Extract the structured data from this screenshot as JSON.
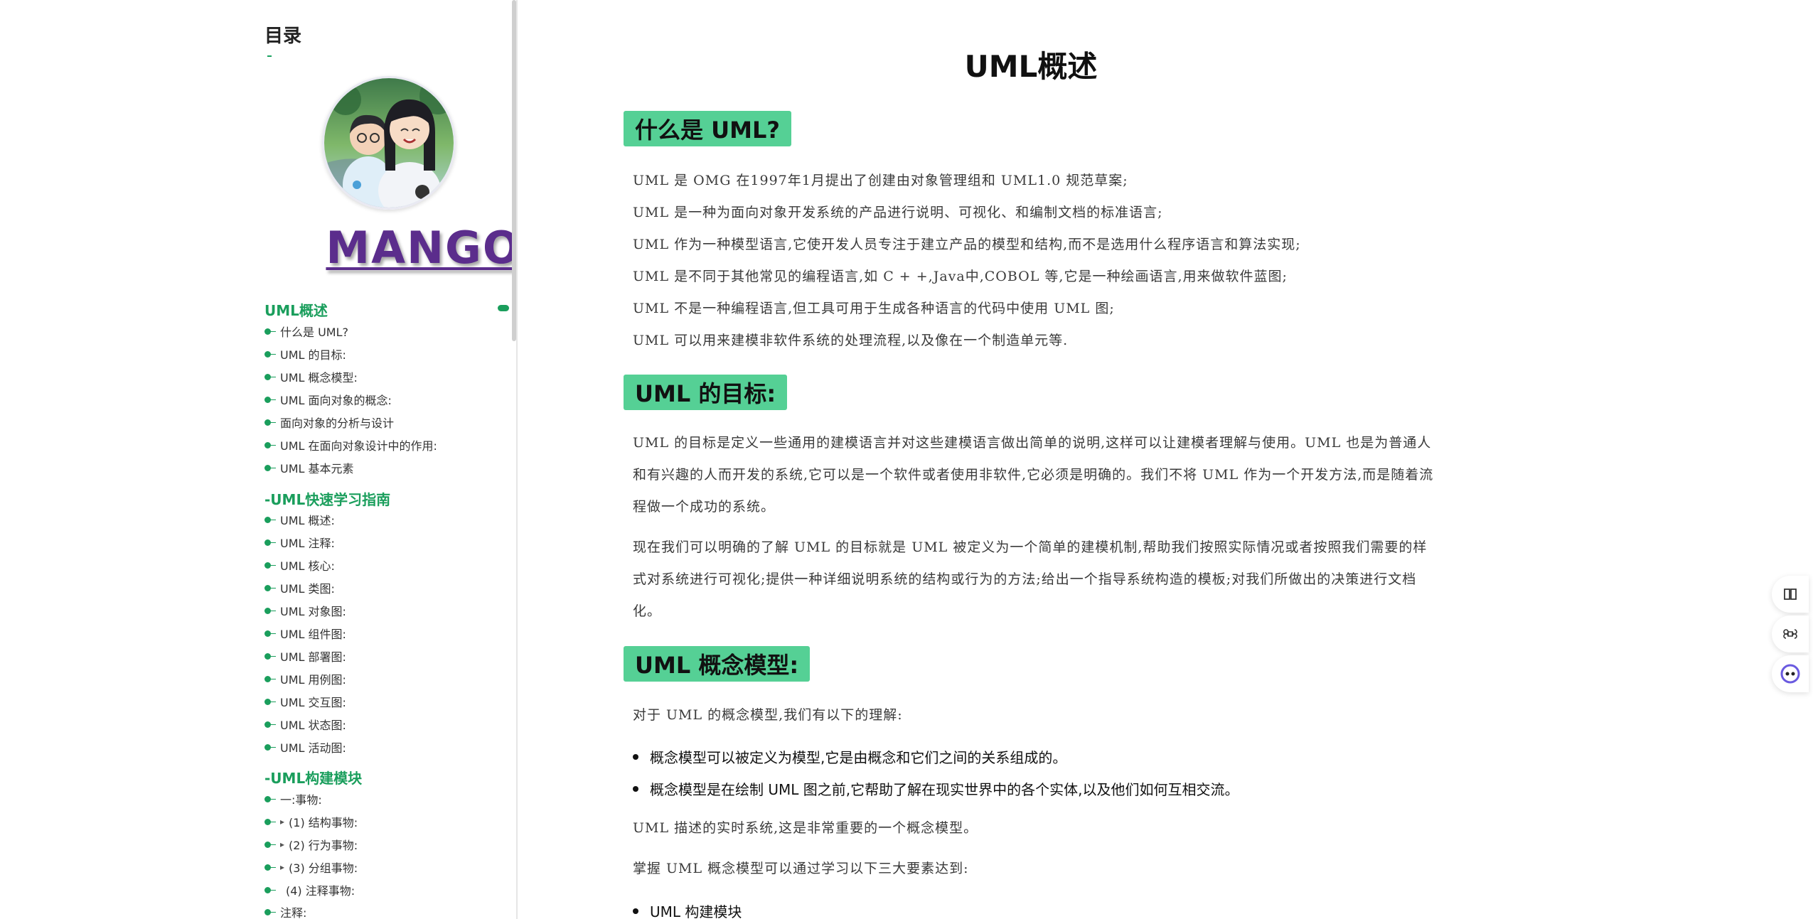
{
  "sidebar": {
    "toc_title": "目录",
    "brand": "MANGO",
    "sections": [
      {
        "title": "UML概述",
        "items": [
          "什么是 UML?",
          "UML 的目标:",
          "UML 概念模型:",
          "UML 面向对象的概念:",
          "面向对象的分析与设计",
          "UML 在面向对象设计中的作用:",
          "UML 基本元素"
        ]
      },
      {
        "title": "-UML快速学习指南",
        "items": [
          "UML 概述:",
          "UML 注释:",
          "UML 核心:",
          "UML 类图:",
          "UML 对象图:",
          "UML 组件图:",
          "UML 部署图:",
          "UML 用例图:",
          "UML 交互图:",
          "UML 状态图:",
          "UML 活动图:"
        ]
      },
      {
        "title": "-UML构建模块",
        "items": [
          "一:事物:",
          "(1) 结构事物:",
          "(2) 行为事物:",
          "(3) 分组事物:",
          "(4) 注释事物:",
          "注释:"
        ]
      }
    ]
  },
  "main": {
    "title": "UML概述",
    "section1": {
      "heading": "什么是 UML?",
      "lines": [
        "UML 是 OMG 在1997年1月提出了创建由对象管理组和 UML1.0 规范草案;",
        "UML 是一种为面向对象开发系统的产品进行说明、可视化、和编制文档的标准语言;",
        "UML 作为一种模型语言,它使开发人员专注于建立产品的模型和结构,而不是选用什么程序语言和算法实现;",
        "UML 是不同于其他常见的编程语言,如 C + +,Java中,COBOL 等,它是一种绘画语言,用来做软件蓝图;",
        "UML 不是一种编程语言,但工具可用于生成各种语言的代码中使用 UML 图;",
        "UML 可以用来建模非软件系统的处理流程,以及像在一个制造单元等."
      ]
    },
    "section2": {
      "heading": "UML 的目标:",
      "para1": "UML 的目标是定义一些通用的建模语言并对这些建模语言做出简单的说明,这样可以让建模者理解与使用。UML 也是为普通人和有兴趣的人而开发的系统,它可以是一个软件或者使用非软件,它必须是明确的。我们不将 UML 作为一个开发方法,而是随着流程做一个成功的系统。",
      "para2": "现在我们可以明确的了解 UML 的目标就是 UML 被定义为一个简单的建模机制,帮助我们按照实际情况或者按照我们需要的样式对系统进行可视化;提供一种详细说明系统的结构或行为的方法;给出一个指导系统构造的模板;对我们所做出的决策进行文档化。"
    },
    "section3": {
      "heading": "UML 概念模型:",
      "intro": "对于 UML 的概念模型,我们有以下的理解:",
      "bullets": [
        "概念模型可以被定义为模型,它是由概念和它们之间的关系组成的。",
        "概念模型是在绘制 UML 图之前,它帮助了解在现实世界中的各个实体,以及他们如何互相交流。"
      ],
      "para1": "UML 描述的实时系统,这是非常重要的一个概念模型。",
      "para2": "掌握 UML 概念模型可以通过学习以下三大要素达到:",
      "bullet_last": "UML 构建模块"
    }
  },
  "colors": {
    "accent": "#1a9e5c",
    "heading_bg": "#55d095",
    "brand": "#5b2d8c"
  },
  "right_tools": [
    "book-icon",
    "command-icon",
    "assistant-icon"
  ]
}
